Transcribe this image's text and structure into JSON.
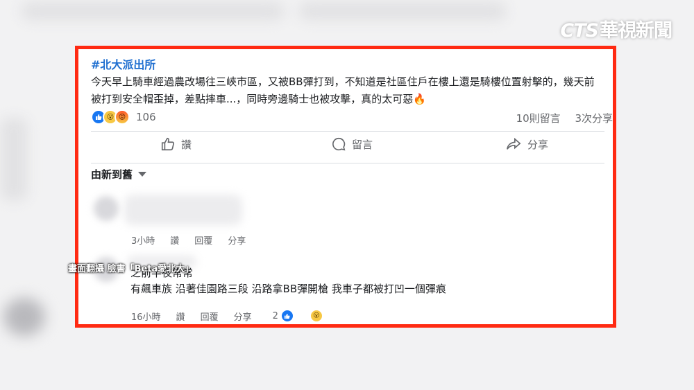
{
  "watermark": {
    "cts": "CTS",
    "name": "華視新聞"
  },
  "post": {
    "hashtag": "#北大派出所",
    "body": "今天早上騎車經過農改場往三峽市區，又被BB彈打到，不知道是社區住戶在樓上還是騎樓位置射擊的，幾天前被打到安全帽歪掉，差點摔車...，同時旁邊騎士也被攻擊，真的太可惡🔥",
    "reaction_count": "106",
    "comments_count": "10則留言",
    "shares_count": "3次分享"
  },
  "actions": {
    "like": "讚",
    "comment": "留言",
    "share": "分享"
  },
  "sort": {
    "label": "由新到舊"
  },
  "comments": [
    {
      "time": "3小時",
      "like": "讚",
      "reply": "回覆",
      "share": "分享"
    },
    {
      "line1": "之前半夜常常",
      "line2": "有飆車族 沿著佳園路三段 沿路拿BB彈開槍 我車子都被打凹一個彈痕",
      "time": "16小時",
      "like": "讚",
      "reply": "回覆",
      "share": "分享",
      "reactions": "2"
    }
  ],
  "overlay_caption": "畫面翻攝 臉書「Beta愛北大」",
  "colors": {
    "frame": "#ff2a12",
    "link": "#1f6fd0",
    "muted": "#65676b",
    "like_blue": "#1877f2"
  },
  "icons": [
    "like-icon",
    "comment-icon",
    "share-icon",
    "fire-icon",
    "chevron-down-icon"
  ]
}
